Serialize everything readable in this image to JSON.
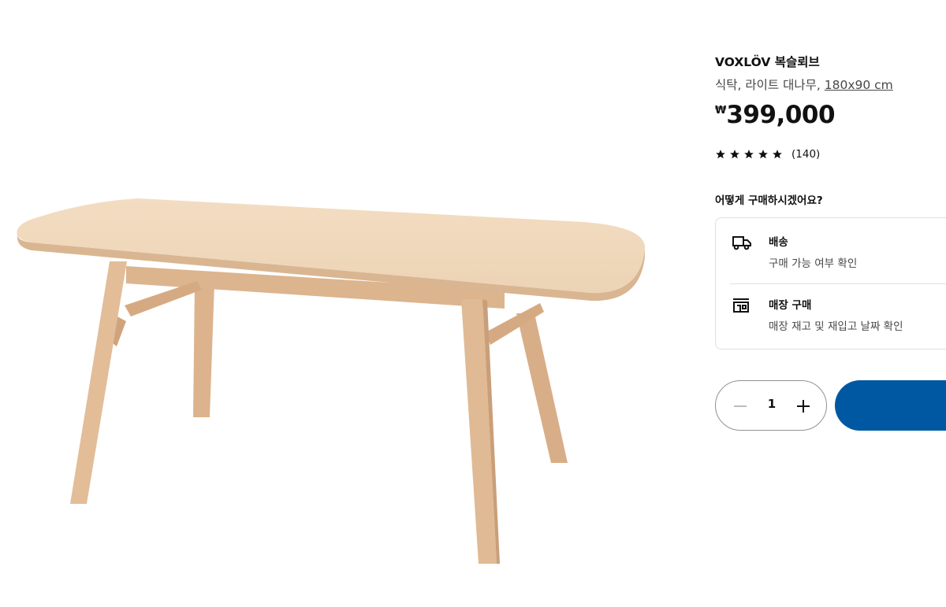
{
  "product": {
    "name": "VOXLÖV 복슬뢰브",
    "description": "식탁, 라이트 대나무,",
    "size": "180x90 cm",
    "price": {
      "currency": "₩",
      "amount": "399,000"
    },
    "rating": {
      "stars": 5,
      "reviews": "(140)"
    },
    "image_icon": "dining-table-image"
  },
  "purchase": {
    "heading": "어떻게 구매하시겠어요?",
    "delivery": {
      "title": "배송",
      "subtitle": "구매 가능 여부 확인",
      "icon": "delivery-truck-icon"
    },
    "store": {
      "title": "매장 구매",
      "subtitle": "매장 재고 및 재입고 날짜 확인",
      "icon": "store-icon"
    }
  },
  "quantity": {
    "value": "1"
  },
  "colors": {
    "accent": "#0058a3",
    "wood_top": "#f0d6b8",
    "wood_leg": "#ddb58f"
  }
}
